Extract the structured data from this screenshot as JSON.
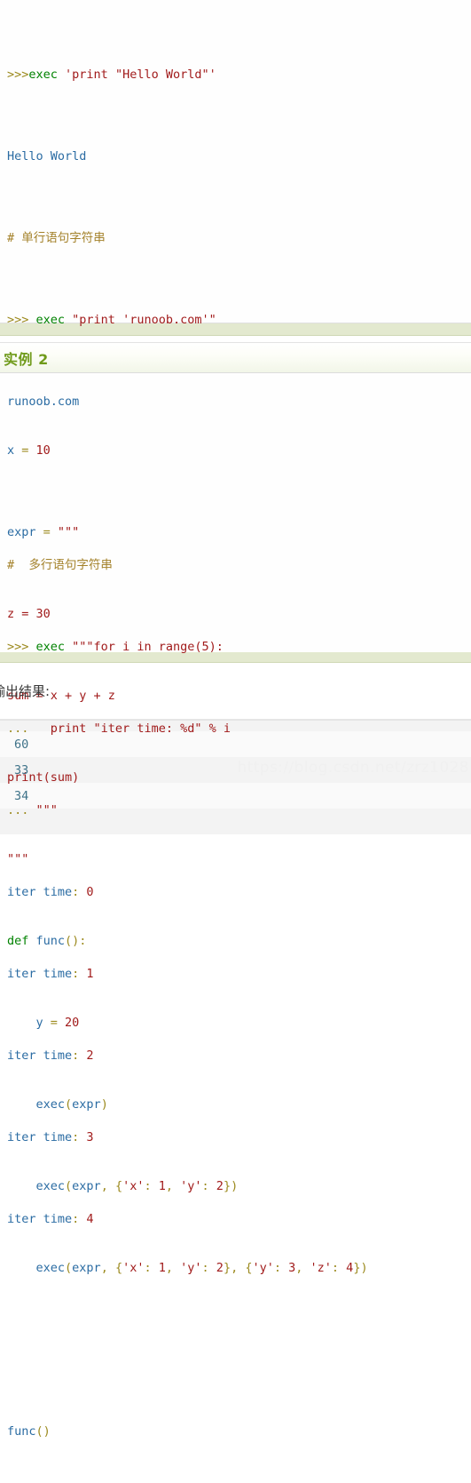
{
  "colors": {
    "prompt": "#9c8a1e",
    "keyword": "#008200",
    "string": "#a11b1b",
    "output_text": "#2b6ca3",
    "comment": "#a4822b",
    "name": "#2b6ca3",
    "punctuation": "#9c8a1e",
    "number": "#a11b1b",
    "example_title": "#6f9a1a",
    "separator_bar": "#e3e9cf",
    "result_value": "#3f7389",
    "watermark": "#f0f0f0"
  },
  "example1": {
    "code_lines": [
      ">>>exec 'print \"Hello World\"'",
      "Hello World",
      "# 单行语句字符串",
      ">>> exec \"print 'runoob.com'\"",
      "runoob.com",
      "",
      "#  多行语句字符串",
      ">>> exec \"\"\"for i in range(5):",
      "...   print \"iter time: %d\" % i",
      "... \"\"\"",
      "iter time: 0",
      "iter time: 1",
      "iter time: 2",
      "iter time: 3",
      "iter time: 4"
    ]
  },
  "example2": {
    "title": "实例 2",
    "code_lines": [
      "x = 10",
      "expr = \"\"\"",
      "z = 30",
      "sum = x + y + z",
      "print(sum)",
      "\"\"\"",
      "def func():",
      "    y = 20",
      "    exec(expr)",
      "    exec(expr, {'x': 1, 'y': 2})",
      "    exec(expr, {'x': 1, 'y': 2}, {'y': 3, 'z': 4})",
      "",
      "func()"
    ]
  },
  "output": {
    "label": "输出结果:",
    "rows": [
      "60",
      "33",
      "34"
    ]
  },
  "watermark": {
    "text": "https://blog.csdn.net/zrz1028"
  }
}
